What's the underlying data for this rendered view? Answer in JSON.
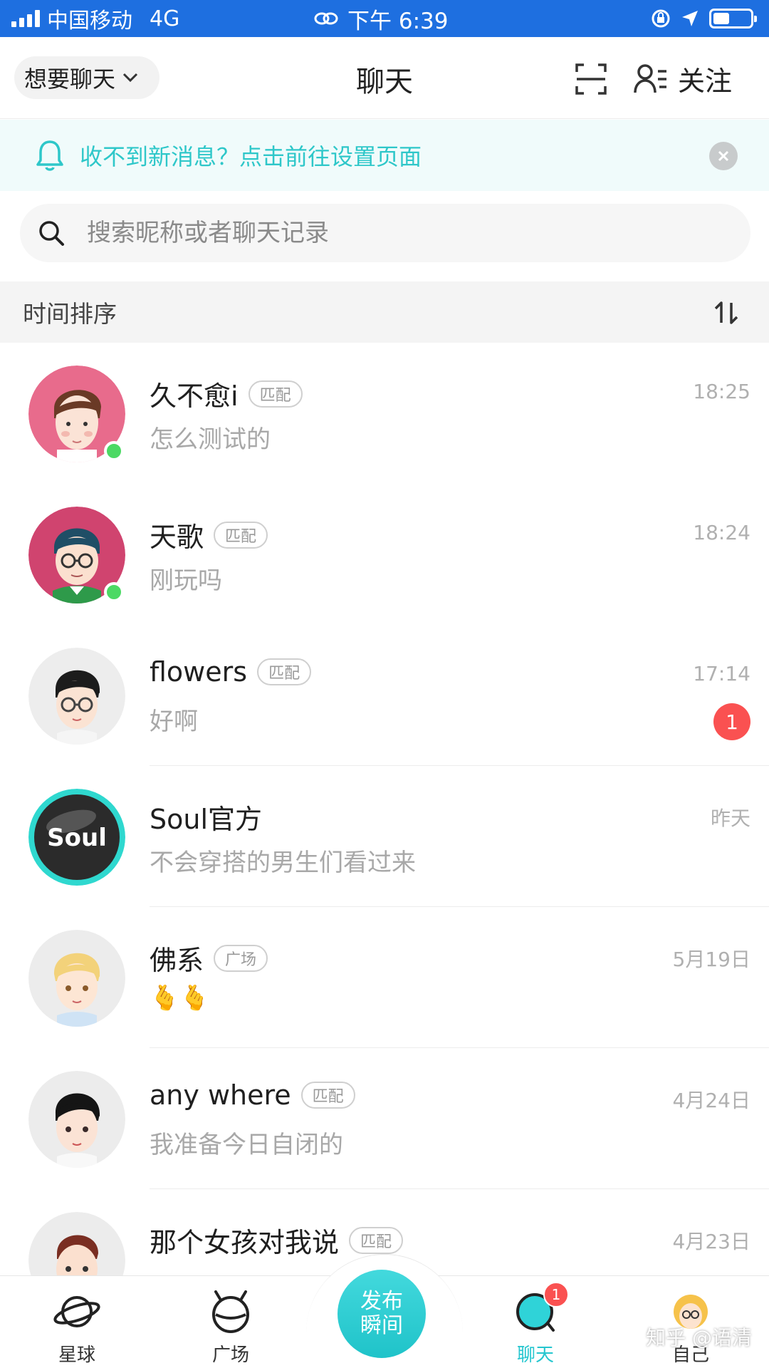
{
  "status_bar": {
    "carrier": "中国移动",
    "network": "4G",
    "time": "下午 6:39"
  },
  "nav": {
    "mode_selector": "想要聊天",
    "title": "聊天",
    "follow_label": "关注"
  },
  "notice": {
    "text": "收不到新消息？点击前往设置页面"
  },
  "search": {
    "placeholder": "搜索昵称或者聊天记录"
  },
  "sort": {
    "label": "时间排序"
  },
  "chats": [
    {
      "name": "久不愈i",
      "tag": "匹配",
      "time": "18:25",
      "message": "怎么测试的",
      "online": true,
      "avatar": "pink-boy-avatar"
    },
    {
      "name": "天歌",
      "tag": "匹配",
      "time": "18:24",
      "message": "刚玩吗",
      "online": true,
      "avatar": "glasses-boy-avatar"
    },
    {
      "name": "flowers",
      "tag": "匹配",
      "time": "17:14",
      "message": "好啊",
      "unread": "1",
      "avatar": "glasses-boy-gray-avatar"
    },
    {
      "name": "Soul官方",
      "time": "昨天",
      "message": "不会穿搭的男生们看过来",
      "avatar": "soul-logo-avatar"
    },
    {
      "name": "佛系",
      "tag": "广场",
      "time": "5月19日",
      "message": "🫰🫰",
      "avatar": "blond-boy-avatar"
    },
    {
      "name": "any where",
      "tag": "匹配",
      "time": "4月24日",
      "message": "我准备今日自闭的",
      "avatar": "dark-hair-boy-avatar"
    },
    {
      "name": "那个女孩对我说",
      "tag": "匹配",
      "time": "4月23日",
      "message": "",
      "avatar": "brown-hair-boy-avatar"
    }
  ],
  "tabbar": {
    "planet": "星球",
    "square": "广场",
    "publish": "发布\n瞬间",
    "chat": "聊天",
    "chat_badge": "1",
    "me": "自己"
  },
  "watermark": "知乎 @语清",
  "colors": {
    "status_bar": "#1e6fe0",
    "accent": "#25c6cf",
    "badge": "#fa5151",
    "online": "#4cd964"
  }
}
